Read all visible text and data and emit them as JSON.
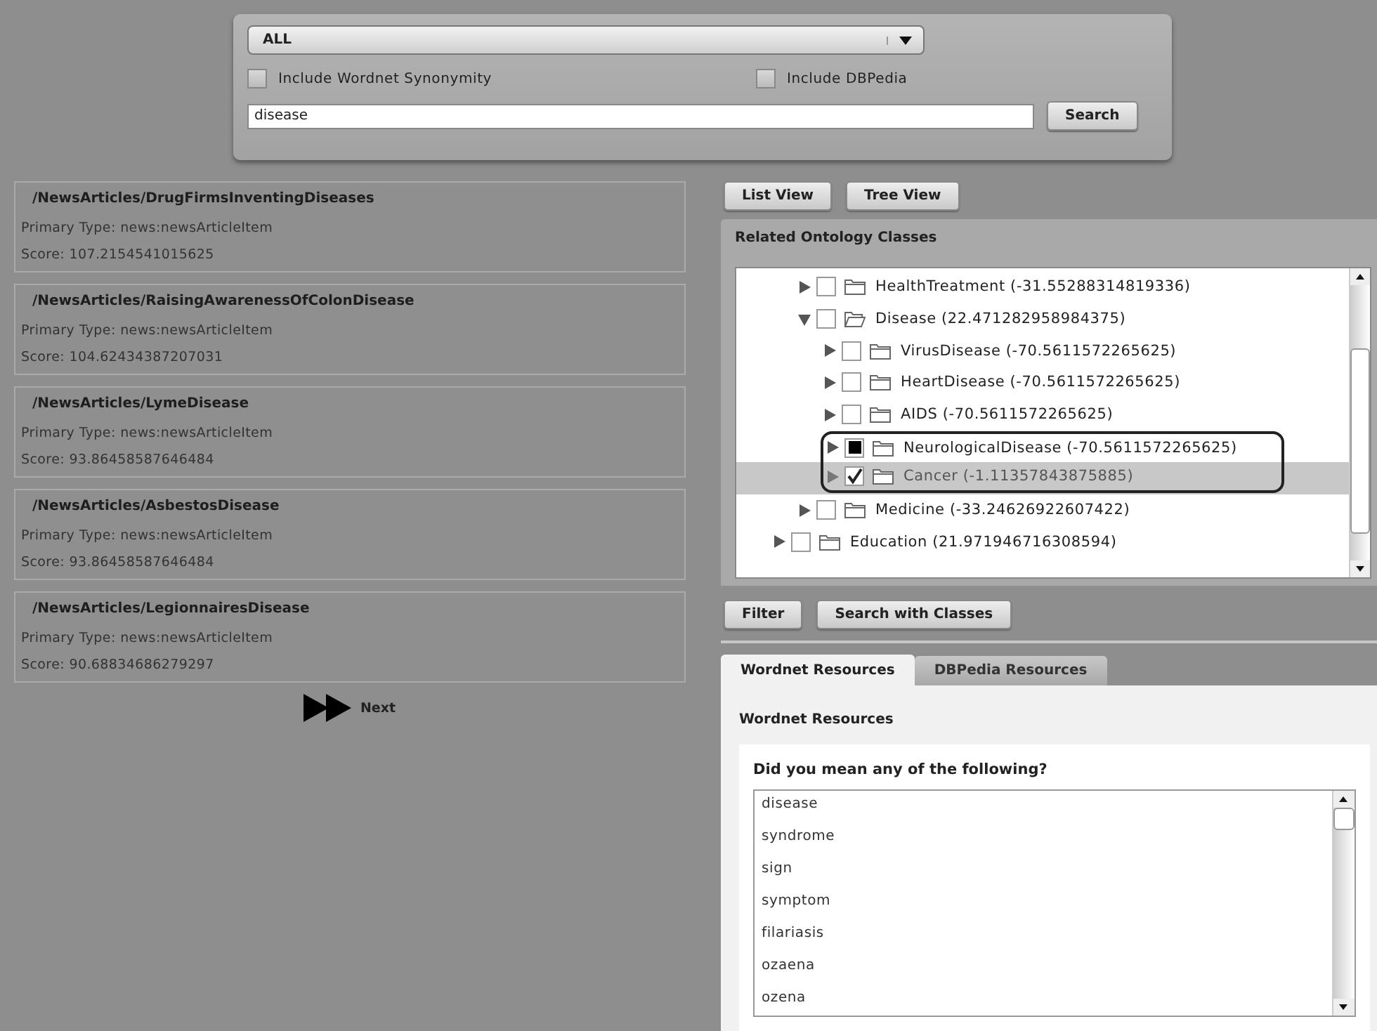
{
  "search": {
    "scope": "ALL",
    "options": [
      {
        "label": "Include Wordnet Synonymity",
        "checked": false
      },
      {
        "label": "Include DBPedia",
        "checked": false
      }
    ],
    "query": "disease",
    "button": "Search"
  },
  "results": [
    {
      "path": "/NewsArticles/DrugFirmsInventingDiseases",
      "type": "Primary Type: news:newsArticleItem",
      "score": "Score: 107.2154541015625"
    },
    {
      "path": "/NewsArticles/RaisingAwarenessOfColonDisease",
      "type": "Primary Type: news:newsArticleItem",
      "score": "Score: 104.62434387207031"
    },
    {
      "path": "/NewsArticles/LymeDisease",
      "type": "Primary Type: news:newsArticleItem",
      "score": "Score: 93.86458587646484"
    },
    {
      "path": "/NewsArticles/AsbestosDisease",
      "type": "Primary Type: news:newsArticleItem",
      "score": "Score: 93.86458587646484"
    },
    {
      "path": "/NewsArticles/LegionnairesDisease",
      "type": "Primary Type: news:newsArticleItem",
      "score": "Score: 90.68834686279297"
    }
  ],
  "pager": {
    "label": "Next"
  },
  "view_buttons": [
    "List View",
    "Tree View"
  ],
  "ontology": {
    "title": "Related Ontology Classes",
    "tree": [
      {
        "children": [
          {
            "children": [
              {
                "label": "HealthTreatment (-31.55288314819336)",
                "expanded": false,
                "checked": false,
                "partial": false,
                "selected": false,
                "outlined": false
              },
              {
                "label": "Disease (22.471282958984375)",
                "expanded": true,
                "checked": false,
                "partial": false,
                "selected": false,
                "outlined": false,
                "children": [
                  {
                    "label": "VirusDisease (-70.5611572265625)",
                    "expanded": false,
                    "checked": false,
                    "partial": false,
                    "selected": false,
                    "outlined": false
                  },
                  {
                    "label": "HeartDisease (-70.5611572265625)",
                    "expanded": false,
                    "checked": false,
                    "partial": false,
                    "selected": false,
                    "outlined": false
                  },
                  {
                    "label": "AIDS (-70.5611572265625)",
                    "expanded": false,
                    "checked": false,
                    "partial": false,
                    "selected": false,
                    "outlined": false
                  },
                  {
                    "label": "NeurologicalDisease (-70.5611572265625)",
                    "expanded": false,
                    "checked": false,
                    "partial": true,
                    "selected": false,
                    "outlined": true
                  },
                  {
                    "label": "Cancer (-1.11357843875885)",
                    "expanded": false,
                    "checked": true,
                    "partial": false,
                    "selected": true,
                    "outlined": true
                  }
                ]
              },
              {
                "label": "Medicine (-33.24626922607422)",
                "expanded": false,
                "checked": false,
                "partial": false,
                "selected": false,
                "outlined": false
              }
            ]
          },
          {
            "label": "Education (21.971946716308594)",
            "expanded": false,
            "checked": false,
            "partial": false,
            "selected": false,
            "outlined": false
          }
        ]
      }
    ]
  },
  "action_buttons": [
    "Filter",
    "Search with Classes"
  ],
  "resource_tabs": [
    {
      "label": "Wordnet Resources",
      "selected": true
    },
    {
      "label": "DBPedia Resources",
      "selected": false
    }
  ],
  "resources": {
    "title": "Wordnet Resources",
    "question": "Did you mean any of the following?",
    "items": [
      "disease",
      "syndrome",
      "sign",
      "symptom",
      "filariasis",
      "ozaena",
      "ozena"
    ]
  }
}
